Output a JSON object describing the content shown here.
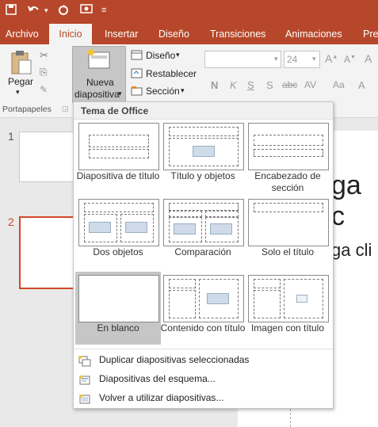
{
  "qat": {
    "save_icon": "save-icon",
    "undo_icon": "undo-icon",
    "redo_icon": "redo-icon",
    "slideshow_icon": "slideshow-icon",
    "customize_icon": "customize-icon"
  },
  "tabs": [
    {
      "label": "Archivo"
    },
    {
      "label": "Inicio"
    },
    {
      "label": "Insertar"
    },
    {
      "label": "Diseño"
    },
    {
      "label": "Transiciones"
    },
    {
      "label": "Animaciones"
    },
    {
      "label": "Pres"
    }
  ],
  "ribbon": {
    "paste_label": "Pegar",
    "new_slide_label_1": "Nueva",
    "new_slide_label_2": "diapositiva",
    "layout_label": "Diseño",
    "reset_label": "Restablecer",
    "section_label": "Sección",
    "font_size": "24",
    "clipboard_group": "Portapapeles"
  },
  "slides": [
    {
      "number": "1"
    },
    {
      "number": "2"
    }
  ],
  "canvas": {
    "text1": "ga c",
    "text2": "ga cli"
  },
  "menu": {
    "header": "Tema de Office",
    "layouts": [
      {
        "label": "Diapositiva de título"
      },
      {
        "label": "Título y objetos"
      },
      {
        "label": "Encabezado de sección"
      },
      {
        "label": "Dos objetos"
      },
      {
        "label": "Comparación"
      },
      {
        "label": "Solo el título"
      },
      {
        "label": "En blanco"
      },
      {
        "label": "Contenido con título"
      },
      {
        "label": "Imagen con título"
      }
    ],
    "items": [
      {
        "label": "Duplicar diapositivas seleccionadas"
      },
      {
        "label": "Diapositivas del esquema..."
      },
      {
        "label": "Volver a utilizar diapositivas..."
      }
    ]
  },
  "colors": {
    "accent": "#b7472a",
    "selected_slide_border": "#d24726"
  }
}
